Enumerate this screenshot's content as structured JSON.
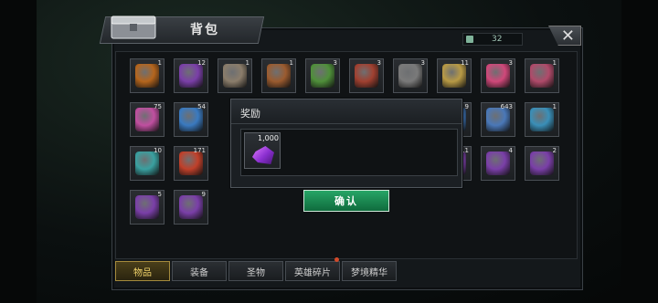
{
  "window": {
    "title": "背包",
    "close_symbol": "✕"
  },
  "currency": {
    "icon": "ticket-icon",
    "value": "32"
  },
  "inventory": {
    "slots": [
      {
        "count": "1",
        "icon": "treasure-chest-icon",
        "color": "#b5651d"
      },
      {
        "count": "12",
        "icon": "purple-chest-icon",
        "color": "#7a3fa8"
      },
      {
        "count": "1",
        "icon": "cube-box-icon",
        "color": "#8b7d6b"
      },
      {
        "count": "1",
        "icon": "wooden-chest-icon",
        "color": "#9b5b2f"
      },
      {
        "count": "3",
        "icon": "green-gear-icon",
        "color": "#4f8f3a"
      },
      {
        "count": "3",
        "icon": "red-coin-icon",
        "color": "#a04030"
      },
      {
        "count": "3",
        "icon": "number-coin-icon",
        "color": "#7a7a7a"
      },
      {
        "count": "11",
        "icon": "24h-card-icon",
        "color": "#b89a45"
      },
      {
        "count": "3",
        "icon": "pink-candy-icon",
        "color": "#d0487a"
      },
      {
        "count": "1",
        "icon": "dice-box-icon",
        "color": "#b04a6a"
      },
      {
        "count": "75",
        "icon": "film-reel-icon",
        "color": "#c04fa0"
      },
      {
        "count": "54",
        "icon": "blue-puck-icon",
        "color": "#3a7ac0"
      },
      {
        "count": "9",
        "icon": "card-icon",
        "color": "#3a6fb0"
      },
      {
        "count": "643",
        "icon": "ticket-stack-icon",
        "color": "#4a78b8"
      },
      {
        "count": "1",
        "icon": "blue-token-icon",
        "color": "#3a8fb8"
      },
      {
        "count": "10",
        "icon": "teal-chip-icon",
        "color": "#3aa0a0"
      },
      {
        "count": "171",
        "icon": "red-chip-icon",
        "color": "#c0402a"
      },
      {
        "count": "11",
        "icon": "purple-scroll-icon",
        "color": "#7a3fa8"
      },
      {
        "count": "4",
        "icon": "purple-scroll-icon",
        "color": "#7a3fa8"
      },
      {
        "count": "2",
        "icon": "purple-scroll-icon",
        "color": "#7a3fa8"
      },
      {
        "count": "5",
        "icon": "purple-scroll-icon",
        "color": "#7a3fa8"
      },
      {
        "count": "9",
        "icon": "purple-scroll-icon",
        "color": "#7a3fa8"
      }
    ]
  },
  "tabs": [
    {
      "label": "物品",
      "active": true
    },
    {
      "label": "装备",
      "active": false
    },
    {
      "label": "圣物",
      "active": false
    },
    {
      "label": "英雄碎片",
      "active": false
    },
    {
      "label": "梦境精华",
      "active": false
    }
  ],
  "dialog": {
    "title": "奖励",
    "reward": {
      "count": "1,000",
      "icon": "purple-gem-icon",
      "color": "#b44ae8"
    },
    "confirm_label": "确认"
  }
}
